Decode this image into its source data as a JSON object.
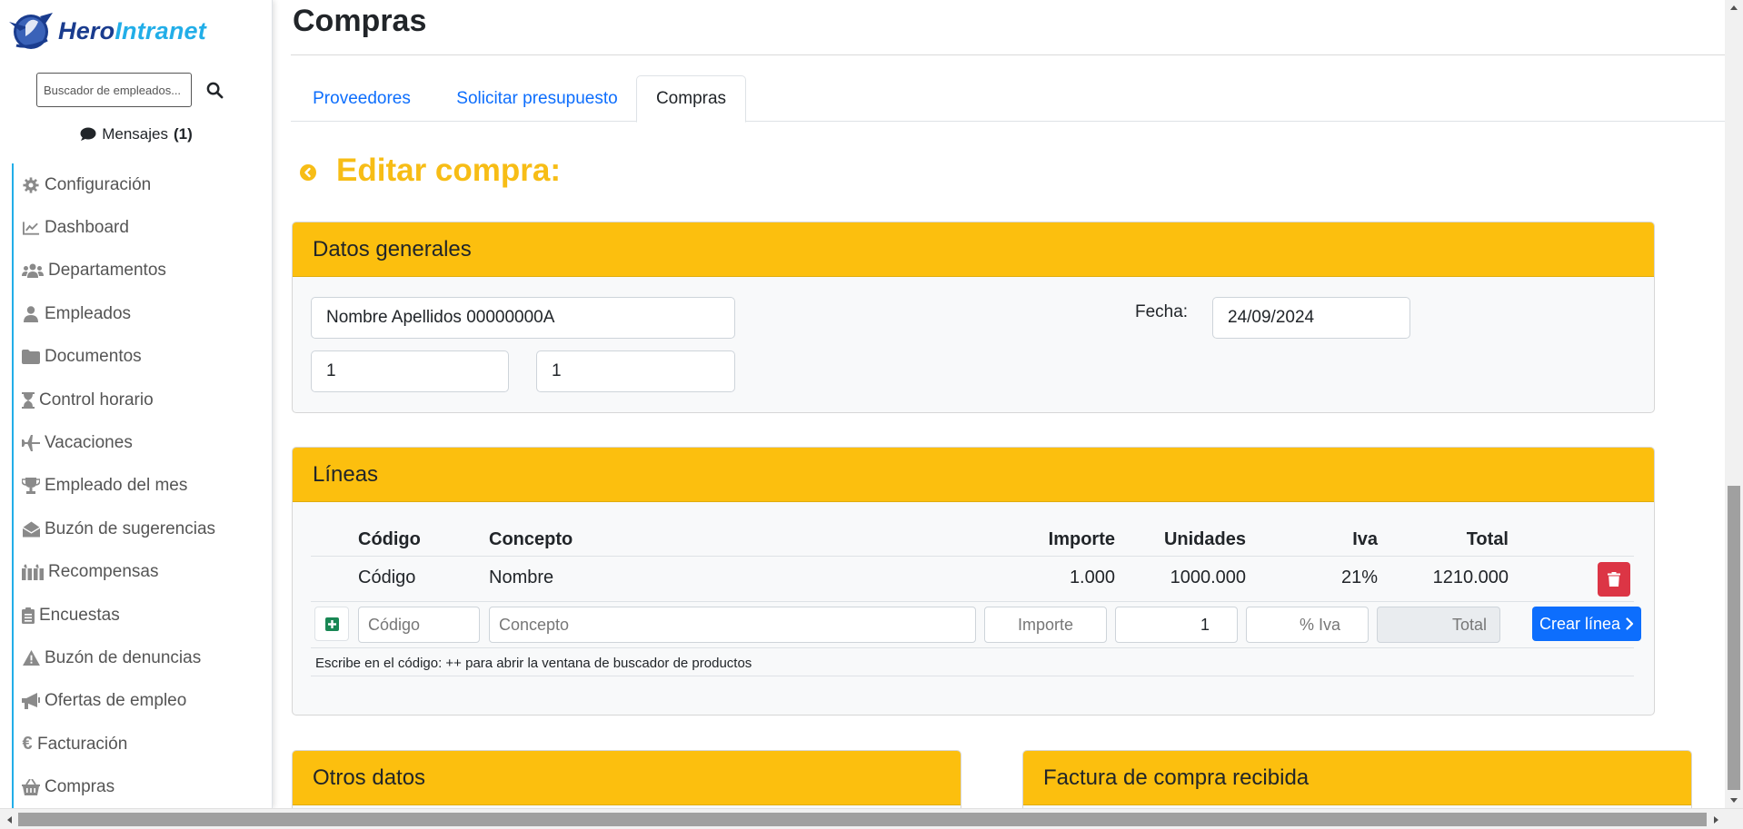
{
  "brand": {
    "part1": "Hero",
    "part2": "Intranet"
  },
  "sidebar": {
    "search_placeholder": "Buscador de empleados...",
    "messages_label": "Mensajes",
    "messages_count": "(1)",
    "items": [
      {
        "label": "Configuración",
        "icon": "gear-icon"
      },
      {
        "label": "Dashboard",
        "icon": "chart-line-icon"
      },
      {
        "label": "Departamentos",
        "icon": "users-icon"
      },
      {
        "label": "Empleados",
        "icon": "user-icon"
      },
      {
        "label": "Documentos",
        "icon": "folder-icon"
      },
      {
        "label": "Control horario",
        "icon": "hourglass-icon"
      },
      {
        "label": "Vacaciones",
        "icon": "plane-icon"
      },
      {
        "label": "Empleado del mes",
        "icon": "trophy-icon"
      },
      {
        "label": "Buzón de sugerencias",
        "icon": "envelope-open-icon"
      },
      {
        "label": "Recompensas",
        "icon": "gift-icon"
      },
      {
        "label": "Encuestas",
        "icon": "clipboard-list-icon"
      },
      {
        "label": "Buzón de denuncias",
        "icon": "warning-icon"
      },
      {
        "label": "Ofertas de empleo",
        "icon": "bullhorn-icon"
      },
      {
        "label": "Facturación",
        "icon": "euro-icon"
      },
      {
        "label": "Compras",
        "icon": "basket-icon"
      }
    ]
  },
  "main": {
    "page_title": "Compras",
    "tabs": [
      {
        "label": "Proveedores",
        "active": false
      },
      {
        "label": "Solicitar presupuesto",
        "active": false
      },
      {
        "label": "Compras",
        "active": true
      }
    ],
    "edit_title": "Editar compra:",
    "general": {
      "header": "Datos generales",
      "provider_value": "Nombre Apellidos 00000000A",
      "date_label": "Fecha:",
      "date_value": "24/09/2024",
      "field_a": "1",
      "field_b": "1"
    },
    "lines": {
      "header": "Líneas",
      "columns": {
        "code": "Código",
        "concept": "Concepto",
        "amount": "Importe",
        "units": "Unidades",
        "vat": "Iva",
        "total": "Total"
      },
      "rows": [
        {
          "code": "Código",
          "concept": "Nombre",
          "amount": "1.000",
          "units": "1000.000",
          "vat": "21%",
          "total": "1210.000"
        }
      ],
      "new_line": {
        "code_placeholder": "Código",
        "concept_placeholder": "Concepto",
        "amount_placeholder": "Importe",
        "units_value": "1",
        "vat_placeholder": "% Iva",
        "total_placeholder": "Total",
        "create_label": "Crear línea"
      },
      "hint": "Escribe en el código: ++ para abrir la ventana de buscador de productos"
    },
    "other_header": "Otros datos",
    "invoice_header": "Factura de compra recibida"
  },
  "colors": {
    "accent": "#fcbf0e",
    "title": "#f7bd16",
    "link": "#0d6efd",
    "danger": "#dc3545",
    "success": "#198754"
  }
}
